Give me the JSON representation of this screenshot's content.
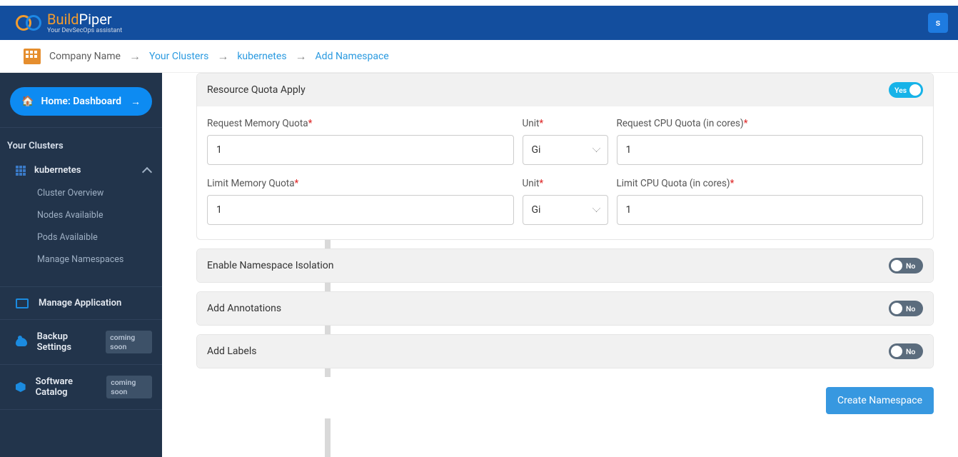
{
  "brand": {
    "name_a": "Build",
    "name_b": "Piper",
    "tag": "Your DevSecOps assistant"
  },
  "user_initial": "s",
  "breadcrumb": {
    "company": "Company Name",
    "clusters": "Your Clusters",
    "cluster": "kubernetes",
    "page": "Add Namespace"
  },
  "side": {
    "home": "Home: Dashboard",
    "section": "Your Clusters",
    "cluster": "kubernetes",
    "kids": [
      "Cluster Overview",
      "Nodes Availaible",
      "Pods Availaible",
      "Manage Namespaces"
    ],
    "manage_app": "Manage Application",
    "backup": "Backup Settings",
    "catalog": "Software Catalog",
    "soon": "coming soon"
  },
  "form": {
    "rqa_title": "Resource Quota Apply",
    "req_mem": "Request Memory Quota",
    "req_mem_v": "1",
    "unit": "Unit",
    "unit_v": "Gi",
    "req_cpu": "Request CPU Quota (in cores)",
    "req_cpu_v": "1",
    "lim_mem": "Limit Memory Quota",
    "lim_mem_v": "1",
    "unit2_v": "Gi",
    "lim_cpu": "Limit CPU Quota (in cores)",
    "lim_cpu_v": "1",
    "iso": "Enable Namespace Isolation",
    "ann": "Add Annotations",
    "lab": "Add Labels",
    "yes": "Yes",
    "no": "No",
    "create": "Create Namespace"
  }
}
